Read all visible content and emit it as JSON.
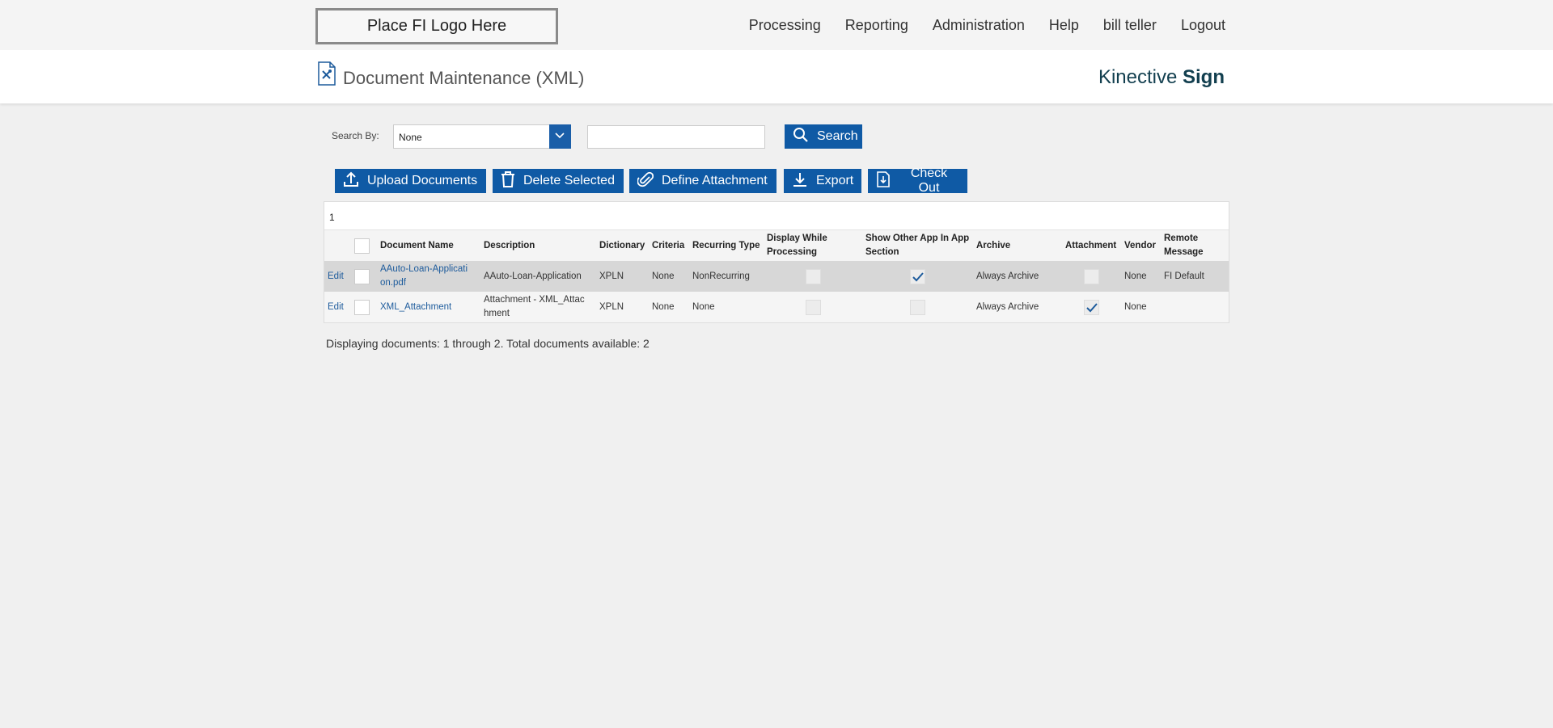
{
  "header": {
    "logo_text": "Place FI Logo Here",
    "nav": [
      "Processing",
      "Reporting",
      "Administration",
      "Help",
      "bill teller",
      "Logout"
    ]
  },
  "titlebar": {
    "title": "Document Maintenance (XML)",
    "brand_light": "Kinective",
    "brand_bold": "Sign"
  },
  "search": {
    "label": "Search By:",
    "select_value": "None",
    "input_value": "",
    "button_label": "Search"
  },
  "actions": {
    "upload": "Upload Documents",
    "delete": "Delete Selected",
    "define": "Define Attachment",
    "export": "Export",
    "checkout": "Check Out"
  },
  "grid": {
    "page": "1",
    "columns": [
      "",
      "",
      "Document Name",
      "Description",
      "Dictionary",
      "Criteria",
      "Recurring Type",
      "Display While Processing",
      "Show Other App In App Section",
      "Archive",
      "Attachment",
      "Vendor",
      "Remote Message"
    ],
    "rows": [
      {
        "edit": "Edit",
        "name": "AAuto-Loan-Applicati on.pdf",
        "description": "AAuto-Loan-Application",
        "dictionary": "XPLN",
        "criteria": "None",
        "recurring": "NonRecurring",
        "display_while_processing": false,
        "show_other_app": true,
        "archive": "Always Archive",
        "attachment": false,
        "vendor": "None",
        "remote_message": "FI Default"
      },
      {
        "edit": "Edit",
        "name": "XML_Attachment",
        "description": "Attachment - XML_Attac hment",
        "dictionary": "XPLN",
        "criteria": "None",
        "recurring": "None",
        "display_while_processing": false,
        "show_other_app": false,
        "archive": "Always Archive",
        "attachment": true,
        "vendor": "None",
        "remote_message": ""
      }
    ]
  },
  "footer": {
    "status": "Displaying documents: 1 through 2. Total documents available: 2"
  },
  "colors": {
    "primary": "#0f5aa5",
    "link": "#1d5b9c",
    "brand": "#123f4f",
    "selected_row": "#d7d7d7"
  }
}
